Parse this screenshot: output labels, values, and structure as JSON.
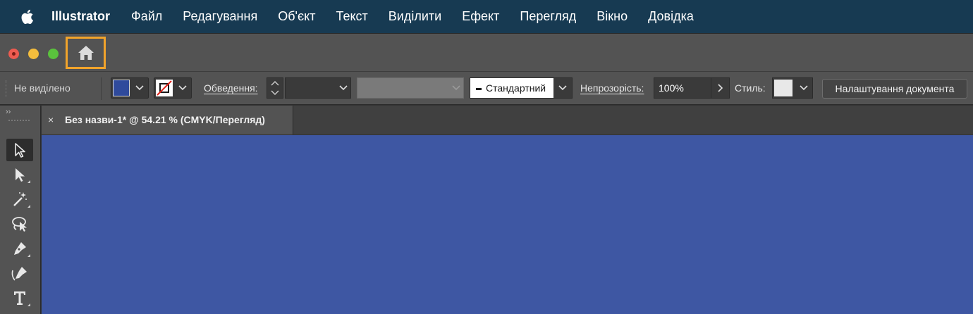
{
  "menubar": {
    "app_name": "Illustrator",
    "items": [
      "Файл",
      "Редагування",
      "Об'єкт",
      "Текст",
      "Виділити",
      "Ефект",
      "Перегляд",
      "Вікно",
      "Довідка"
    ]
  },
  "control_bar": {
    "selection_status": "Не виділено",
    "fill_color": "#2f4a9c",
    "stroke_label": "Обведення:",
    "brush_value": "Стандартний",
    "opacity_label": "Непрозорість:",
    "opacity_value": "100%",
    "style_label": "Стиль:",
    "doc_setup_label": "Налаштування документа"
  },
  "document": {
    "tab_title": "Без назви-1* @ 54.21 % (CMYK/Перегляд)",
    "tab_close": "×",
    "canvas_color": "#3e57a3"
  },
  "tools": [
    "selection-tool",
    "direct-selection-tool",
    "magic-wand-tool",
    "lasso-tool",
    "pen-tool",
    "curvature-tool",
    "type-tool"
  ],
  "highlight_color": "#f2a42b"
}
